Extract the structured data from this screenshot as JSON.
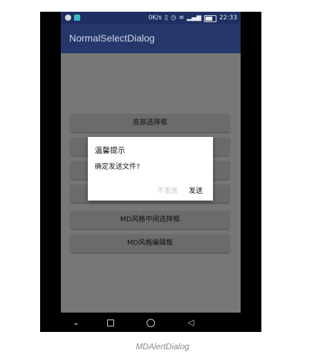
{
  "status_bar": {
    "speed": "0K/s",
    "time": "22:33"
  },
  "app_bar": {
    "title": "NormalSelectDialog"
  },
  "menu": [
    {
      "label": "底部选择框"
    },
    {
      "label": ""
    },
    {
      "label": ""
    },
    {
      "label": ""
    },
    {
      "label": "MD风格中间选择框"
    },
    {
      "label": "MD风格编辑框"
    }
  ],
  "dialog": {
    "title": "温馨提示",
    "message": "确定发送文件?",
    "negative": "不发送",
    "positive": "发送"
  },
  "caption": "MDAlertDialog"
}
